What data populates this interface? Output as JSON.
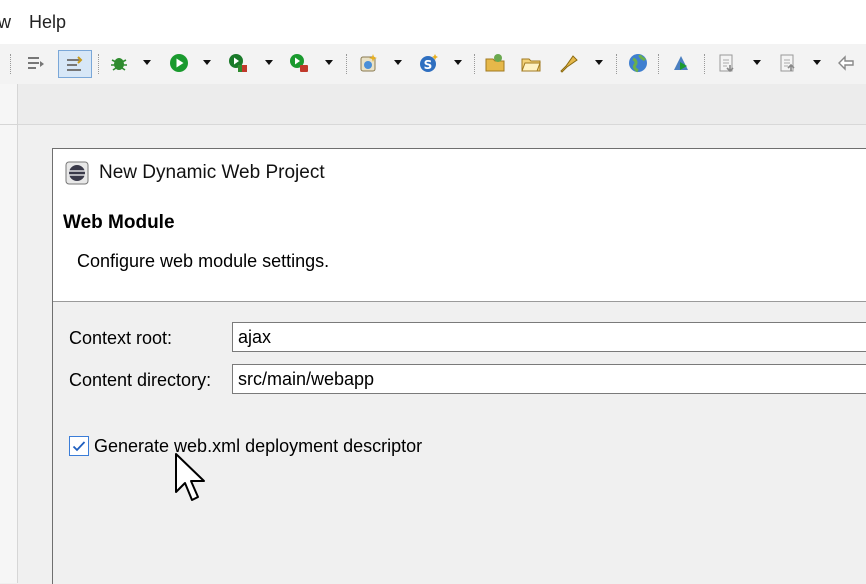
{
  "menubar": {
    "items": [
      "w",
      "Help"
    ]
  },
  "toolbar": {
    "icons": [
      "next-annotation-icon",
      "toggle-mark-occurrences-icon",
      "debug-icon",
      "run-icon",
      "coverage-icon",
      "run-last-tool-icon",
      "new-server-icon",
      "new-service-icon",
      "open-folder-icon",
      "open-project-icon",
      "bookmark-icon",
      "web-browser-icon",
      "run-on-server-icon",
      "next-edit-icon",
      "previous-edit-icon",
      "back-icon"
    ]
  },
  "dialog": {
    "title": "New Dynamic Web Project",
    "section_title": "Web Module",
    "section_desc": "Configure web module settings.",
    "context_root_label": "Context root:",
    "context_root_value": "ajax",
    "content_dir_label": "Content directory:",
    "content_dir_value": "src/main/webapp",
    "generate_label": "Generate web.xml deployment descriptor",
    "generate_checked": true
  },
  "colors": {
    "accent": "#3b7dd8",
    "run_green": "#1a9a2e",
    "debug_green": "#2e8b2e"
  }
}
